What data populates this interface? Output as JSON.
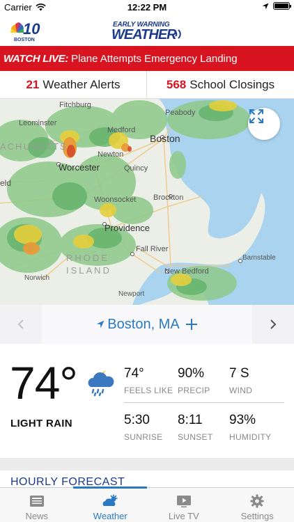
{
  "status_bar": {
    "carrier": "Carrier",
    "time": "12:22 PM"
  },
  "header": {
    "station_logo_text": "10",
    "station_city": "BOSTON",
    "brand_top": "EARLY WARNING",
    "brand_main": "WEATHER"
  },
  "banner": {
    "tag": "WATCH LIVE:",
    "text": "Plane Attempts Emergency Landing"
  },
  "alerts": {
    "weather_count": "21",
    "weather_label": "Weather Alerts",
    "school_count": "568",
    "school_label": "School Closings"
  },
  "map": {
    "labels": [
      "Fitchburg",
      "Peabody",
      "Leominster",
      "Medford",
      "Boston",
      "ACHUSETTS",
      "Worcester",
      "Newton",
      "Quincy",
      "eld",
      "Brockton",
      "Woonsocket",
      "Providence",
      "RHODE",
      "ISLAND",
      "Fall River",
      "Barnstable",
      "New Bedford",
      "Norwich",
      "Newport"
    ]
  },
  "location": {
    "name": "Boston, MA",
    "prev_icon": "chevron-left-icon",
    "next_icon": "chevron-right-icon"
  },
  "current": {
    "temp": "74°",
    "condition": "LIGHT RAIN",
    "condition_icon": "partly-cloudy-rain-icon",
    "stats": [
      {
        "value": "74°",
        "label": "FEELS LIKE"
      },
      {
        "value": "90%",
        "label": "PRECIP"
      },
      {
        "value": "7 S",
        "label": "WIND"
      },
      {
        "value": "5:30",
        "label": "SUNRISE"
      },
      {
        "value": "8:11",
        "label": "SUNSET"
      },
      {
        "value": "93%",
        "label": "HUMIDITY"
      }
    ]
  },
  "hourly": {
    "title": "HOURLY FORECAST"
  },
  "tabs": [
    {
      "label": "News",
      "icon": "news-icon",
      "active": false
    },
    {
      "label": "Weather",
      "icon": "weather-icon",
      "active": true
    },
    {
      "label": "Live TV",
      "icon": "play-icon",
      "active": false
    },
    {
      "label": "Settings",
      "icon": "gear-icon",
      "active": false
    }
  ],
  "colors": {
    "accent": "#2b79c2",
    "banner": "#d7141f",
    "brand": "#1b3a8a"
  }
}
